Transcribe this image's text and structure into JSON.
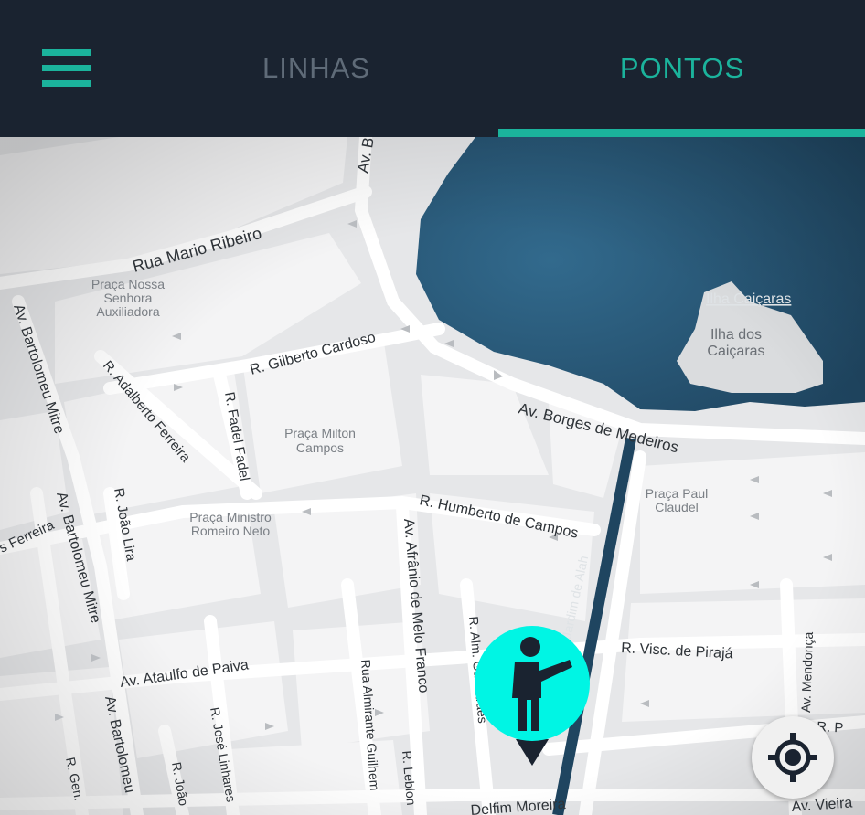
{
  "header": {
    "menu_icon": "hamburger-menu-icon",
    "tabs": [
      {
        "label": "LINHAS",
        "active": false
      },
      {
        "label": "PONTOS",
        "active": true
      }
    ],
    "accent_color": "#1bb39c",
    "background_color": "#1a2330"
  },
  "map": {
    "water_color": "#2a5a7a",
    "labels": {
      "av_b_top": "Av. B",
      "rua_mario_ribeiro": "Rua Mario Ribeiro",
      "praca_nossa_senhora_1": "Praça Nossa",
      "praca_nossa_senhora_2": "Senhora",
      "praca_nossa_senhora_3": "Auxiliadora",
      "ilha_caicaras_label": "Ilha Caiçaras",
      "ilha_dos_1": "Ilha dos",
      "ilha_dos_2": "Caiçaras",
      "r_gilberto_cardoso": "R. Gilberto Cardoso",
      "av_bartolomeu_mitre_1": "Av. Bartolomeu Mitre",
      "r_adalberto_ferreira": "R. Adalberto Ferreira",
      "r_fadel_fadel": "R. Fadel Fadel",
      "praca_milton_1": "Praça Milton",
      "praca_milton_2": "Campos",
      "av_borges_de_medeiros": "Av. Borges de Medeiros",
      "praca_paul_1": "Praça Paul",
      "praca_paul_2": "Claudel",
      "r_humberto_de_campos": "R. Humberto de Campos",
      "av_bartolomeu_mitre_2": "Av. Bartolomeu Mitre",
      "r_joao_lira": "R. João Lira",
      "s_ferreira": "s Ferreira",
      "praca_ministro_1": "Praça Ministro",
      "praca_ministro_2": "Romeiro Neto",
      "av_afranio_de_melo_franco": "Av. Afrânio de Melo Franco",
      "jardim_de_alah": "Jardim de Alah",
      "r_visc_de_piraja": "R. Visc. de Pirajá",
      "r_alm_guimaraes": "R. Alm. Guimarães",
      "av_ataulfo_de_paiva": "Av. Ataulfo de Paiva",
      "rua_almirante_guilhem": "Rua Almirante Guilhem",
      "av_bartolomeu_3": "Av. Bartolomeu",
      "r_jose_linhares": "R. José Linhares",
      "av_mendonca": "Av. Mendonça",
      "r_p_right": "R. P",
      "r_gen": "R. Gen.",
      "r_joao_bottom": "R. João",
      "r_leblon": "R. Leblon",
      "delfim_moreira": "Delfim Moreira",
      "av_vieira": "Av. Vieira"
    }
  },
  "stop_marker": {
    "icon": "person-hailing-bus-icon",
    "color": "#00f5e4"
  },
  "locate_button": {
    "icon": "crosshair-locate-icon"
  }
}
